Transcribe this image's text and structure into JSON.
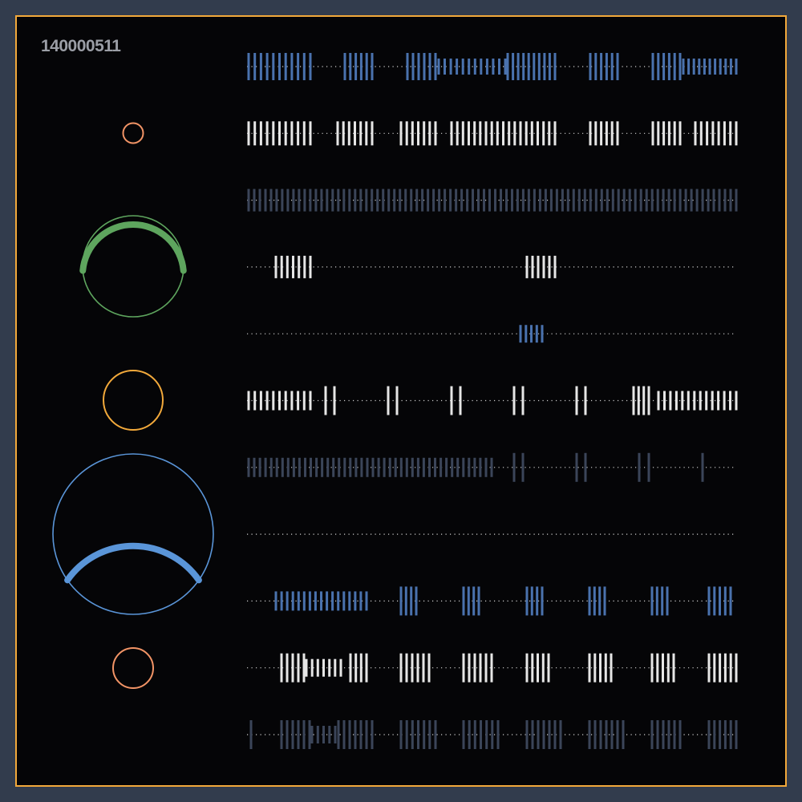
{
  "counter_text": "140000511",
  "colors": {
    "background": "#323c4d",
    "panel": "#050507",
    "frame": "#f2a93b",
    "blue": "#4a72ae",
    "white": "#e6e6e6",
    "slate": "#3b4559",
    "dots": "#d0d0d0",
    "green": "#5ea55e",
    "orange": "#f2a93b",
    "salmon": "#f29466",
    "ring_blue": "#5a95d8"
  },
  "rings": [
    {
      "name": "ring-small-top",
      "color": "salmon",
      "arc": null
    },
    {
      "name": "ring-green",
      "color": "green",
      "arc": {
        "start_deg": 95,
        "end_deg": 265
      }
    },
    {
      "name": "ring-orange",
      "color": "orange",
      "arc": null
    },
    {
      "name": "ring-large-blue",
      "color": "ring_blue",
      "arc": {
        "start_deg": 125,
        "end_deg": 235
      }
    },
    {
      "name": "ring-small-bottom",
      "color": "salmon",
      "arc": null
    }
  ],
  "tracks": [
    {
      "color": "blue",
      "patterns": [
        [
          310,
          387,
          11,
          34
        ],
        [
          430,
          464,
          6,
          34
        ],
        [
          508,
          543,
          6,
          34
        ],
        [
          547,
          630,
          12,
          20
        ],
        [
          633,
          692,
          10,
          34
        ],
        [
          736,
          770,
          6,
          34
        ],
        [
          814,
          848,
          6,
          34
        ],
        [
          852,
          918,
          11,
          20
        ]
      ]
    },
    {
      "color": "white",
      "patterns": [
        [
          310,
          387,
          11,
          30
        ],
        [
          421,
          464,
          7,
          30
        ],
        [
          500,
          543,
          7,
          30
        ],
        [
          563,
          692,
          19,
          30
        ],
        [
          736,
          770,
          6,
          30
        ],
        [
          814,
          848,
          6,
          30
        ],
        [
          867,
          918,
          8,
          30
        ]
      ]
    },
    {
      "color": "slate",
      "patterns": [
        [
          310,
          918,
          88,
          28
        ]
      ]
    },
    {
      "color": "white",
      "patterns": [
        [
          344,
          387,
          7,
          28
        ],
        [
          657,
          692,
          6,
          28
        ]
      ]
    },
    {
      "color": "blue",
      "patterns": [
        [
          649,
          676,
          5,
          22
        ]
      ]
    },
    {
      "color": "white",
      "patterns": [
        [
          310,
          387,
          11,
          24
        ],
        [
          406,
          417,
          2,
          36
        ],
        [
          484,
          495,
          2,
          36
        ],
        [
          563,
          574,
          2,
          36
        ],
        [
          641,
          652,
          2,
          36
        ],
        [
          719,
          730,
          2,
          36
        ],
        [
          790,
          809,
          4,
          36
        ],
        [
          821,
          918,
          14,
          24
        ]
      ]
    },
    {
      "color": "slate",
      "patterns": [
        [
          310,
          613,
          44,
          24
        ],
        [
          641,
          652,
          2,
          36
        ],
        [
          719,
          730,
          2,
          36
        ],
        [
          797,
          809,
          2,
          36
        ],
        [
          876,
          878,
          1,
          36
        ]
      ]
    },
    {
      "color": "blue",
      "patterns": []
    },
    {
      "color": "blue",
      "patterns": [
        [
          344,
          457,
          17,
          24
        ],
        [
          500,
          519,
          4,
          36
        ],
        [
          578,
          597,
          4,
          36
        ],
        [
          657,
          676,
          4,
          36
        ],
        [
          735,
          754,
          4,
          36
        ],
        [
          813,
          832,
          4,
          36
        ],
        [
          884,
          911,
          5,
          36
        ]
      ]
    },
    {
      "color": "white",
      "patterns": [
        [
          351,
          379,
          5,
          36
        ],
        [
          382,
          425,
          7,
          22
        ],
        [
          437,
          457,
          4,
          36
        ],
        [
          500,
          535,
          6,
          36
        ],
        [
          578,
          613,
          6,
          36
        ],
        [
          657,
          684,
          5,
          36
        ],
        [
          735,
          762,
          5,
          36
        ],
        [
          813,
          840,
          5,
          36
        ],
        [
          884,
          918,
          6,
          36
        ]
      ]
    },
    {
      "color": "slate",
      "patterns": [
        [
          313,
          315,
          1,
          36
        ],
        [
          351,
          386,
          6,
          36
        ],
        [
          389,
          418,
          5,
          22
        ],
        [
          422,
          464,
          7,
          36
        ],
        [
          500,
          543,
          7,
          36
        ],
        [
          578,
          621,
          7,
          36
        ],
        [
          657,
          699,
          7,
          36
        ],
        [
          735,
          777,
          7,
          36
        ],
        [
          813,
          848,
          6,
          36
        ],
        [
          884,
          918,
          6,
          36
        ]
      ]
    }
  ]
}
